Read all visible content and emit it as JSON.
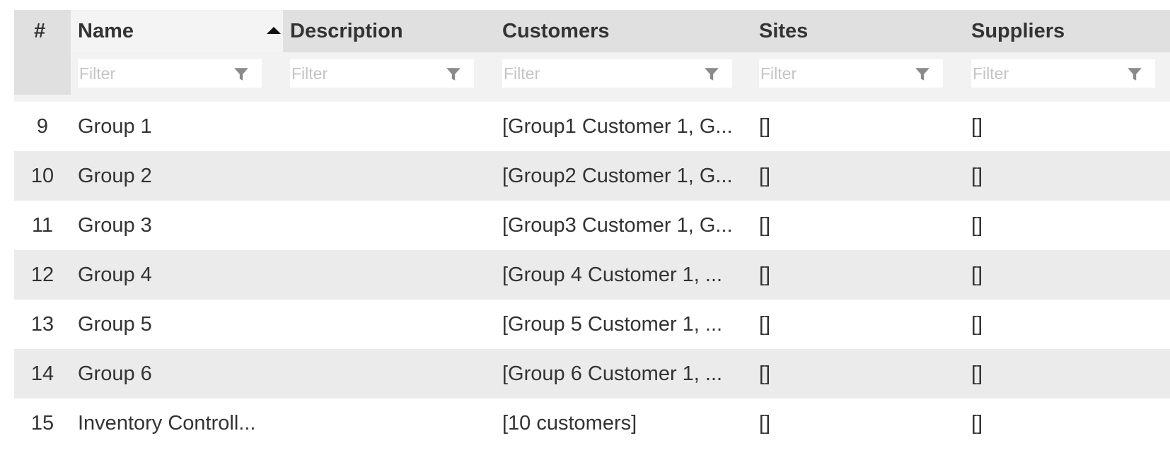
{
  "columns": {
    "num": "#",
    "name": "Name",
    "description": "Description",
    "customers": "Customers",
    "sites": "Sites",
    "suppliers": "Suppliers"
  },
  "filter_placeholder": "Filter",
  "sort": {
    "column": "Name",
    "direction": "ascending"
  },
  "icons": {
    "sort": "sort-ascending-icon",
    "filter": "funnel-filter-icon"
  },
  "colors": {
    "header_bg": "#e0e0e0",
    "row_alt_bg": "#ebebeb",
    "text": "#333333",
    "placeholder": "#c4c4c4"
  },
  "rows": [
    {
      "num": "9",
      "name": "Group 1",
      "description": "",
      "customers": "[Group1 Customer 1, G...",
      "sites": "[]",
      "suppliers": "[]"
    },
    {
      "num": "10",
      "name": "Group 2",
      "description": "",
      "customers": "[Group2 Customer 1, G...",
      "sites": "[]",
      "suppliers": "[]"
    },
    {
      "num": "11",
      "name": "Group 3",
      "description": "",
      "customers": "[Group3 Customer 1, G...",
      "sites": "[]",
      "suppliers": "[]"
    },
    {
      "num": "12",
      "name": "Group 4",
      "description": "",
      "customers": "[Group 4 Customer 1, ...",
      "sites": "[]",
      "suppliers": "[]"
    },
    {
      "num": "13",
      "name": "Group 5",
      "description": "",
      "customers": "[Group 5 Customer 1, ...",
      "sites": "[]",
      "suppliers": "[]"
    },
    {
      "num": "14",
      "name": "Group 6",
      "description": "",
      "customers": "[Group 6 Customer 1, ...",
      "sites": "[]",
      "suppliers": "[]"
    },
    {
      "num": "15",
      "name": "Inventory Controll...",
      "description": "",
      "customers": "[10 customers]",
      "sites": "[]",
      "suppliers": "[]"
    }
  ]
}
